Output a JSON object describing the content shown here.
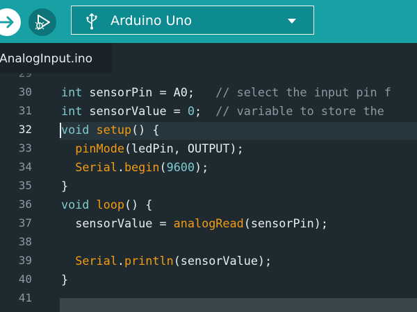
{
  "toolbar": {
    "verify_icon": "arrow-right-icon",
    "debug_icon": "debug-play-icon",
    "board_icon": "usb-icon",
    "board_name": "Arduino Uno",
    "board_chevron_icon": "chevron-down-icon",
    "accent_color": "#17a1a5"
  },
  "tabs": [
    {
      "label": "AnalogInput.ino"
    }
  ],
  "editor": {
    "top_partial_line": "29",
    "line_numbers": [
      "30",
      "31",
      "32",
      "33",
      "34",
      "35",
      "36",
      "37",
      "38",
      "39",
      "40",
      "41"
    ],
    "active_line": "32",
    "lines": {
      "l30": {
        "kw": "int",
        "code": " sensorPin = A0;   ",
        "comment": "// select the input pin f"
      },
      "l31": {
        "kw": "int",
        "code": " sensorValue = ",
        "num": "0",
        "code2": ";  ",
        "comment": "// variable to store the"
      },
      "l32": {
        "kw": "void",
        "code": " ",
        "fn": "setup",
        "code2": "() {"
      },
      "l33": {
        "indent": "  ",
        "fn": "pinMode",
        "code": "(ledPin, OUTPUT);"
      },
      "l34": {
        "indent": "  ",
        "fn": "Serial",
        "code": ".",
        "fn2": "begin",
        "code2": "(",
        "num": "9600",
        "code3": ");"
      },
      "l35": {
        "code": "}"
      },
      "l36": {
        "kw": "void",
        "code": " ",
        "fn": "loop",
        "code2": "() {"
      },
      "l37": {
        "indent": "  ",
        "code": "sensorValue = ",
        "fn": "analogRead",
        "code2": "(sensorPin);"
      },
      "l38": {
        "code": ""
      },
      "l39": {
        "indent": "  ",
        "fn": "Serial",
        "code": ".",
        "fn2": "println",
        "code2": "(sensorValue);"
      },
      "l40": {
        "code": "}"
      },
      "l41": {
        "code": ""
      }
    }
  }
}
